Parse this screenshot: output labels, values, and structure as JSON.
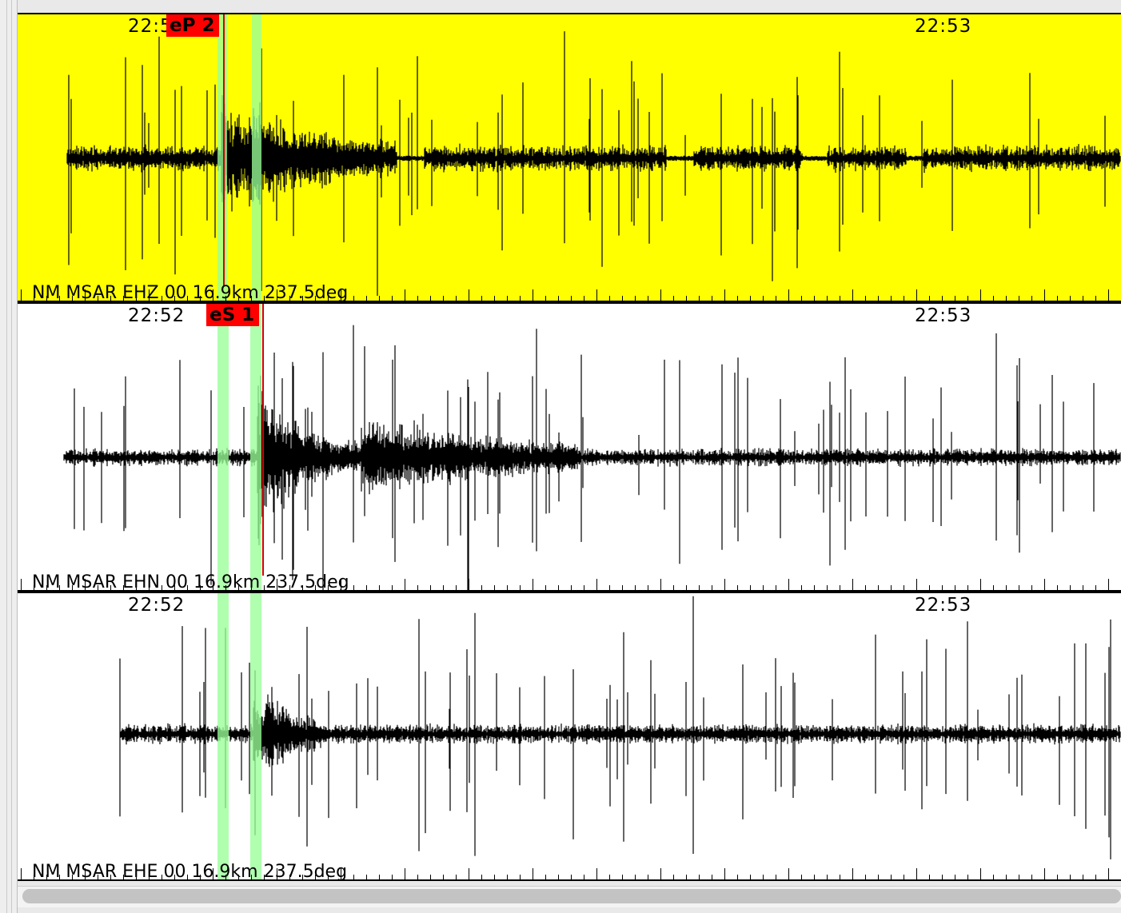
{
  "colors": {
    "selected_panel_bg": "#ffff00",
    "panel_bg": "#ffffff",
    "waveform": "#000000",
    "pick_flag": "#ff0000",
    "phase_window_band": "#98ff98"
  },
  "panels": [
    {
      "selected": true,
      "channel_label": "NM MSAR EHZ 00 16.9km 237.5deg",
      "time_labels": [
        "22:5",
        "22:53"
      ],
      "pick": {
        "label": "eP 2"
      }
    },
    {
      "selected": false,
      "channel_label": "NM MSAR EHN 00 16.9km 237.5deg",
      "time_labels": [
        "22:52",
        "22:53"
      ],
      "pick": {
        "label": "eS 1"
      }
    },
    {
      "selected": false,
      "channel_label": "NM MSAR EHE 00 16.9km 237.5deg",
      "time_labels": [
        "22:52",
        "22:53"
      ],
      "pick": null
    }
  ],
  "icons": {
    "scrollbar": "horizontal-scrollbar"
  }
}
